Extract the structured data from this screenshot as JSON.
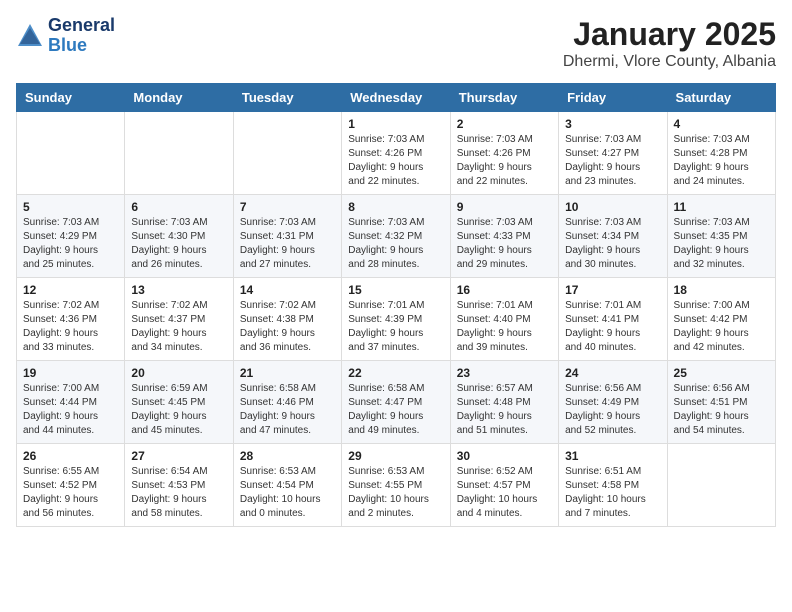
{
  "header": {
    "logo_line1": "General",
    "logo_line2": "Blue",
    "title": "January 2025",
    "subtitle": "Dhermi, Vlore County, Albania"
  },
  "days_of_week": [
    "Sunday",
    "Monday",
    "Tuesday",
    "Wednesday",
    "Thursday",
    "Friday",
    "Saturday"
  ],
  "weeks": [
    [
      {
        "day": null,
        "info": null
      },
      {
        "day": null,
        "info": null
      },
      {
        "day": null,
        "info": null
      },
      {
        "day": "1",
        "info": "Sunrise: 7:03 AM\nSunset: 4:26 PM\nDaylight: 9 hours\nand 22 minutes."
      },
      {
        "day": "2",
        "info": "Sunrise: 7:03 AM\nSunset: 4:26 PM\nDaylight: 9 hours\nand 22 minutes."
      },
      {
        "day": "3",
        "info": "Sunrise: 7:03 AM\nSunset: 4:27 PM\nDaylight: 9 hours\nand 23 minutes."
      },
      {
        "day": "4",
        "info": "Sunrise: 7:03 AM\nSunset: 4:28 PM\nDaylight: 9 hours\nand 24 minutes."
      }
    ],
    [
      {
        "day": "5",
        "info": "Sunrise: 7:03 AM\nSunset: 4:29 PM\nDaylight: 9 hours\nand 25 minutes."
      },
      {
        "day": "6",
        "info": "Sunrise: 7:03 AM\nSunset: 4:30 PM\nDaylight: 9 hours\nand 26 minutes."
      },
      {
        "day": "7",
        "info": "Sunrise: 7:03 AM\nSunset: 4:31 PM\nDaylight: 9 hours\nand 27 minutes."
      },
      {
        "day": "8",
        "info": "Sunrise: 7:03 AM\nSunset: 4:32 PM\nDaylight: 9 hours\nand 28 minutes."
      },
      {
        "day": "9",
        "info": "Sunrise: 7:03 AM\nSunset: 4:33 PM\nDaylight: 9 hours\nand 29 minutes."
      },
      {
        "day": "10",
        "info": "Sunrise: 7:03 AM\nSunset: 4:34 PM\nDaylight: 9 hours\nand 30 minutes."
      },
      {
        "day": "11",
        "info": "Sunrise: 7:03 AM\nSunset: 4:35 PM\nDaylight: 9 hours\nand 32 minutes."
      }
    ],
    [
      {
        "day": "12",
        "info": "Sunrise: 7:02 AM\nSunset: 4:36 PM\nDaylight: 9 hours\nand 33 minutes."
      },
      {
        "day": "13",
        "info": "Sunrise: 7:02 AM\nSunset: 4:37 PM\nDaylight: 9 hours\nand 34 minutes."
      },
      {
        "day": "14",
        "info": "Sunrise: 7:02 AM\nSunset: 4:38 PM\nDaylight: 9 hours\nand 36 minutes."
      },
      {
        "day": "15",
        "info": "Sunrise: 7:01 AM\nSunset: 4:39 PM\nDaylight: 9 hours\nand 37 minutes."
      },
      {
        "day": "16",
        "info": "Sunrise: 7:01 AM\nSunset: 4:40 PM\nDaylight: 9 hours\nand 39 minutes."
      },
      {
        "day": "17",
        "info": "Sunrise: 7:01 AM\nSunset: 4:41 PM\nDaylight: 9 hours\nand 40 minutes."
      },
      {
        "day": "18",
        "info": "Sunrise: 7:00 AM\nSunset: 4:42 PM\nDaylight: 9 hours\nand 42 minutes."
      }
    ],
    [
      {
        "day": "19",
        "info": "Sunrise: 7:00 AM\nSunset: 4:44 PM\nDaylight: 9 hours\nand 44 minutes."
      },
      {
        "day": "20",
        "info": "Sunrise: 6:59 AM\nSunset: 4:45 PM\nDaylight: 9 hours\nand 45 minutes."
      },
      {
        "day": "21",
        "info": "Sunrise: 6:58 AM\nSunset: 4:46 PM\nDaylight: 9 hours\nand 47 minutes."
      },
      {
        "day": "22",
        "info": "Sunrise: 6:58 AM\nSunset: 4:47 PM\nDaylight: 9 hours\nand 49 minutes."
      },
      {
        "day": "23",
        "info": "Sunrise: 6:57 AM\nSunset: 4:48 PM\nDaylight: 9 hours\nand 51 minutes."
      },
      {
        "day": "24",
        "info": "Sunrise: 6:56 AM\nSunset: 4:49 PM\nDaylight: 9 hours\nand 52 minutes."
      },
      {
        "day": "25",
        "info": "Sunrise: 6:56 AM\nSunset: 4:51 PM\nDaylight: 9 hours\nand 54 minutes."
      }
    ],
    [
      {
        "day": "26",
        "info": "Sunrise: 6:55 AM\nSunset: 4:52 PM\nDaylight: 9 hours\nand 56 minutes."
      },
      {
        "day": "27",
        "info": "Sunrise: 6:54 AM\nSunset: 4:53 PM\nDaylight: 9 hours\nand 58 minutes."
      },
      {
        "day": "28",
        "info": "Sunrise: 6:53 AM\nSunset: 4:54 PM\nDaylight: 10 hours\nand 0 minutes."
      },
      {
        "day": "29",
        "info": "Sunrise: 6:53 AM\nSunset: 4:55 PM\nDaylight: 10 hours\nand 2 minutes."
      },
      {
        "day": "30",
        "info": "Sunrise: 6:52 AM\nSunset: 4:57 PM\nDaylight: 10 hours\nand 4 minutes."
      },
      {
        "day": "31",
        "info": "Sunrise: 6:51 AM\nSunset: 4:58 PM\nDaylight: 10 hours\nand 7 minutes."
      },
      {
        "day": null,
        "info": null
      }
    ]
  ]
}
